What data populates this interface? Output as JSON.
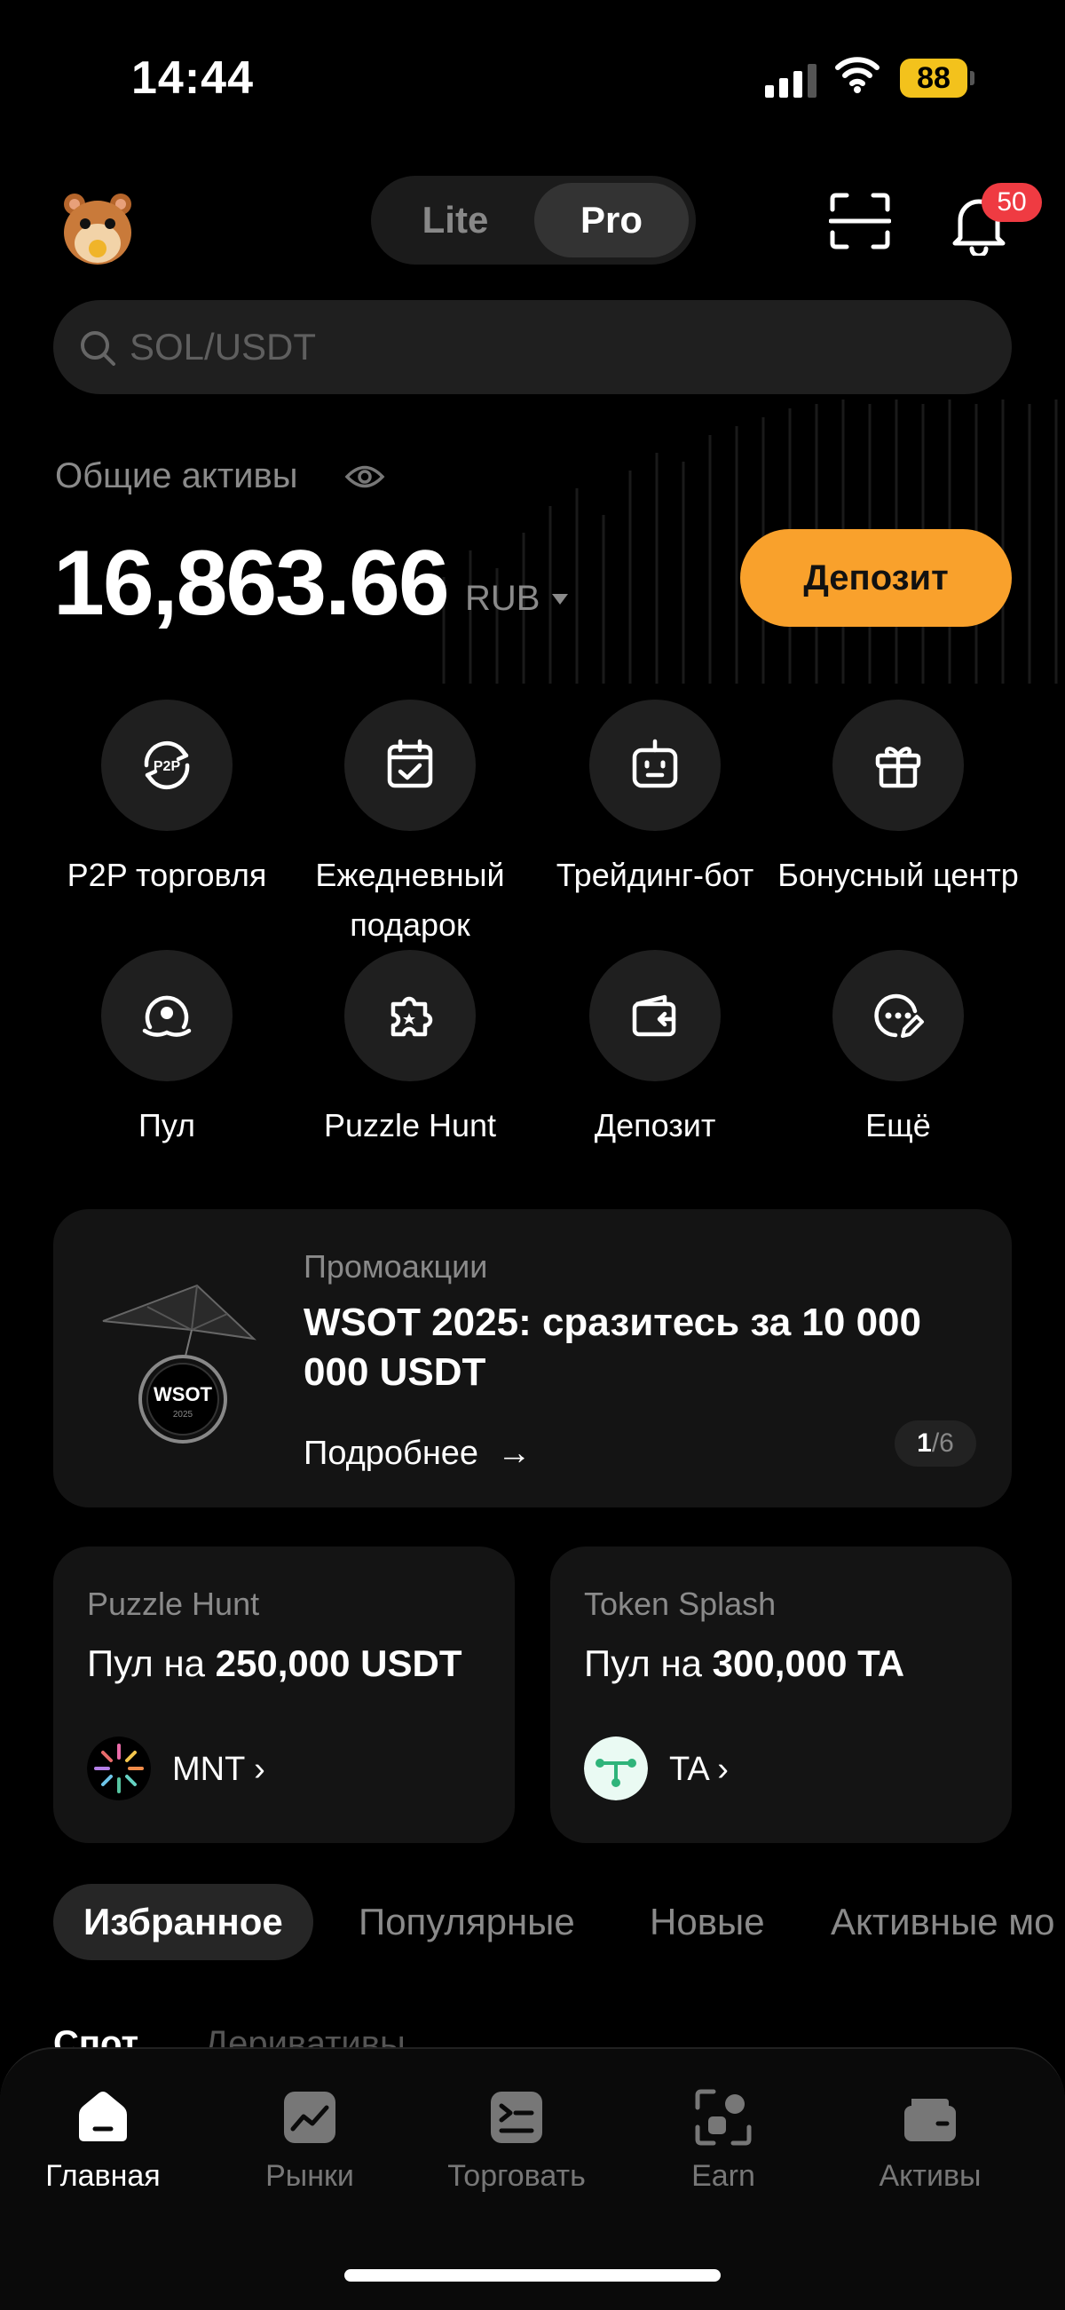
{
  "status_bar": {
    "time": "14:44",
    "battery": "88"
  },
  "header": {
    "mode_lite": "Lite",
    "mode_pro": "Pro",
    "notifications_count": "50"
  },
  "search": {
    "placeholder": "SOL/USDT"
  },
  "assets": {
    "label": "Общие активы",
    "value": "16,863.66",
    "currency": "RUB",
    "deposit_button": "Депозит"
  },
  "quick_actions": [
    {
      "label": "P2P торговля",
      "icon": "p2p-icon"
    },
    {
      "label": "Ежедневный подарок",
      "icon": "calendar-check-icon"
    },
    {
      "label": "Трейдинг-бот",
      "icon": "bot-icon"
    },
    {
      "label": "Бонусный центр",
      "icon": "gift-icon"
    },
    {
      "label": "Пул",
      "icon": "pool-icon"
    },
    {
      "label": "Puzzle Hunt",
      "icon": "puzzle-icon"
    },
    {
      "label": "Депозит",
      "icon": "wallet-in-icon"
    },
    {
      "label": "Ещё",
      "icon": "more-icon"
    }
  ],
  "promo": {
    "category": "Промоакции",
    "title": "WSOT 2025: сразитесь за 10 000 000 USDT",
    "link": "Подробнее",
    "page_current": "1",
    "page_total": "/6"
  },
  "cards": [
    {
      "category": "Puzzle Hunt",
      "prefix": "Пул на",
      "amount": "250,000 USDT",
      "ticker": "MNT"
    },
    {
      "category": "Token Splash",
      "prefix": "Пул на",
      "amount": "300,000 TA",
      "ticker": "TA"
    }
  ],
  "tabs": [
    "Избранное",
    "Популярные",
    "Новые",
    "Активные мо"
  ],
  "subtabs": [
    "Спот",
    "Деривативы"
  ],
  "bottom_nav": [
    {
      "label": "Главная",
      "icon": "home-icon"
    },
    {
      "label": "Рынки",
      "icon": "markets-icon"
    },
    {
      "label": "Торговать",
      "icon": "trade-icon"
    },
    {
      "label": "Earn",
      "icon": "earn-icon"
    },
    {
      "label": "Активы",
      "icon": "wallet-icon"
    }
  ],
  "colors": {
    "accent": "#f9a12c",
    "badge": "#ef3b42",
    "background": "#000000"
  }
}
